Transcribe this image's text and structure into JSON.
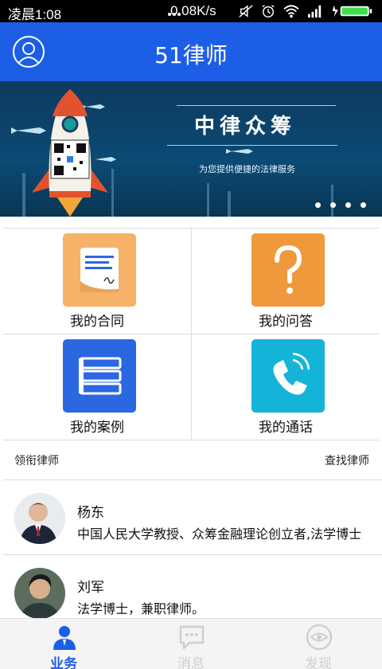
{
  "status_bar": {
    "time": "凌晨1:08",
    "net_speed": "0.08K/s",
    "icons": [
      "more-dots-icon",
      "mute-icon",
      "alarm-icon",
      "wifi-icon",
      "signal-icon",
      "battery-charging-icon"
    ]
  },
  "header": {
    "title": "51律师",
    "icon": "user-avatar-icon"
  },
  "banner": {
    "title": "中律众筹",
    "subtitle": "为您提供便捷的法律服务",
    "page_count": 4,
    "bg_color": "#0b4a74"
  },
  "grid": [
    {
      "label": "我的合同",
      "icon": "contract-document-icon",
      "color": "#f5b268"
    },
    {
      "label": "我的问答",
      "icon": "question-mark-icon",
      "color": "#f0983c"
    },
    {
      "label": "我的案例",
      "icon": "case-stack-icon",
      "color": "#2b67e0"
    },
    {
      "label": "我的通话",
      "icon": "phone-call-icon",
      "color": "#14b4d9"
    }
  ],
  "section": {
    "left": "领衔律师",
    "right": "查找律师"
  },
  "lawyers": [
    {
      "name": "杨东",
      "desc": "中国人民大学教授、众筹金融理论创立者,法学博士"
    },
    {
      "name": "刘军",
      "desc": "法学博士，兼职律师。"
    }
  ],
  "tabs": [
    {
      "label": "业务",
      "icon": "business-person-icon",
      "active": true
    },
    {
      "label": "消息",
      "icon": "message-bubble-icon",
      "active": false
    },
    {
      "label": "发现",
      "icon": "discover-eye-icon",
      "active": false
    }
  ],
  "colors": {
    "primary": "#1c5ee6",
    "inactive_tab": "#cfcfcf"
  }
}
